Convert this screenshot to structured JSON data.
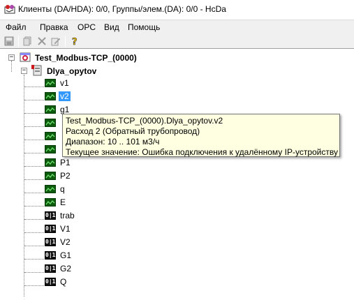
{
  "window": {
    "title": "Клиенты (DA/HDA): 0/0, Группы/элем.(DA): 0/0 - HcDa"
  },
  "menu": {
    "items": [
      "Файл",
      "Правка",
      "OPC",
      "Вид",
      "Помощь"
    ]
  },
  "toolbar": {
    "buttons": [
      "save-icon",
      "copy-icon",
      "delete-icon",
      "properties-icon",
      "help-icon"
    ]
  },
  "tree": {
    "server": {
      "label": "Test_Modbus-TCP_(0000)",
      "expander": "−"
    },
    "group": {
      "label": "Dlya_opytov",
      "expander": "−"
    },
    "items": [
      {
        "label": "v1",
        "type": "analog"
      },
      {
        "label": "v2",
        "type": "analog",
        "selected": true
      },
      {
        "label": "g1",
        "type": "analog"
      },
      {
        "label": "",
        "type": "analog"
      },
      {
        "label": "",
        "type": "analog"
      },
      {
        "label": "",
        "type": "analog"
      },
      {
        "label": "P1",
        "type": "analog"
      },
      {
        "label": "P2",
        "type": "analog"
      },
      {
        "label": "q",
        "type": "analog"
      },
      {
        "label": "E",
        "type": "analog"
      },
      {
        "label": "trab",
        "type": "discrete"
      },
      {
        "label": "V1",
        "type": "discrete"
      },
      {
        "label": "V2",
        "type": "discrete"
      },
      {
        "label": "G1",
        "type": "discrete"
      },
      {
        "label": "G2",
        "type": "discrete"
      },
      {
        "label": "Q",
        "type": "discrete"
      }
    ],
    "discrete_badge": "0|1"
  },
  "tooltip": {
    "line1": "Test_Modbus-TCP_(0000).Dlya_opytov.v2",
    "line2": "Расход 2 (Обратный трубопровод)",
    "line3": "Диапазон: 10 .. 101 м3/ч",
    "line4": "Текущее значение: Ошибка подключения к удалённому IP-устройству"
  }
}
